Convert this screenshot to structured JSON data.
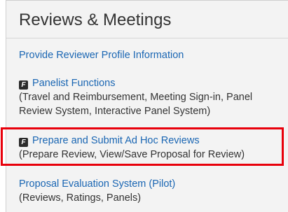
{
  "panel": {
    "title": "Reviews & Meetings",
    "items": [
      {
        "link": "Provide Reviewer Profile Information"
      },
      {
        "badge": "F",
        "link": "Panelist Functions",
        "desc_line1": "(Travel and Reimbursement, Meeting Sign-in, Panel",
        "desc_line2": "Review System, Interactive Panel System)"
      },
      {
        "badge": "F",
        "link": "Prepare and Submit Ad Hoc Reviews",
        "desc_line1": "(Prepare Review, View/Save Proposal for Review)"
      },
      {
        "link": "Proposal Evaluation System (Pilot)",
        "desc_line1": "(Reviews, Ratings, Panels)"
      }
    ]
  },
  "colors": {
    "link": "#1a66b3",
    "highlight": "#e8000b",
    "panel_bg": "#f3f3f3"
  }
}
